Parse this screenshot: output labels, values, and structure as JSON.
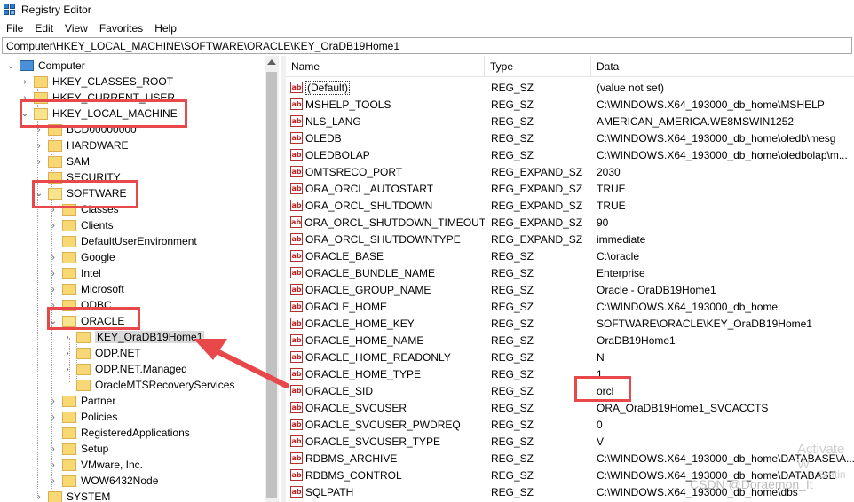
{
  "window": {
    "title": "Registry Editor"
  },
  "menu": [
    "File",
    "Edit",
    "View",
    "Favorites",
    "Help"
  ],
  "address": "Computer\\HKEY_LOCAL_MACHINE\\SOFTWARE\\ORACLE\\KEY_OraDB19Home1",
  "tree": {
    "root": "Computer",
    "hkcr": "HKEY_CLASSES_ROOT",
    "hkcu": "HKEY_CURRENT_USER",
    "hklm": "HKEY_LOCAL_MACHINE",
    "bcd": "BCD00000000",
    "hardware": "HARDWARE",
    "sam": "SAM",
    "security": "SECURITY",
    "software": "SOFTWARE",
    "classes": "Classes",
    "clients": "Clients",
    "defaultuserenv": "DefaultUserEnvironment",
    "google": "Google",
    "intel": "Intel",
    "microsoft": "Microsoft",
    "odbc": "ODBC",
    "oracle": "ORACLE",
    "key_oradb": "KEY_OraDB19Home1",
    "odp_net": "ODP.NET",
    "odp_net_managed": "ODP.NET.Managed",
    "oraclemts": "OracleMTSRecoveryServices",
    "partner": "Partner",
    "policies": "Policies",
    "registeredapps": "RegisteredApplications",
    "setup": "Setup",
    "vmware": "VMware, Inc.",
    "wow6432": "WOW6432Node",
    "system": "SYSTEM"
  },
  "columns": {
    "name": "Name",
    "type": "Type",
    "data": "Data"
  },
  "values": [
    {
      "name": "(Default)",
      "type": "REG_SZ",
      "data": "(value not set)"
    },
    {
      "name": "MSHELP_TOOLS",
      "type": "REG_SZ",
      "data": "C:\\WINDOWS.X64_193000_db_home\\MSHELP"
    },
    {
      "name": "NLS_LANG",
      "type": "REG_SZ",
      "data": "AMERICAN_AMERICA.WE8MSWIN1252"
    },
    {
      "name": "OLEDB",
      "type": "REG_SZ",
      "data": "C:\\WINDOWS.X64_193000_db_home\\oledb\\mesg"
    },
    {
      "name": "OLEDBOLAP",
      "type": "REG_SZ",
      "data": "C:\\WINDOWS.X64_193000_db_home\\oledbolap\\m..."
    },
    {
      "name": "OMTSRECO_PORT",
      "type": "REG_EXPAND_SZ",
      "data": "2030"
    },
    {
      "name": "ORA_ORCL_AUTOSTART",
      "type": "REG_EXPAND_SZ",
      "data": "TRUE"
    },
    {
      "name": "ORA_ORCL_SHUTDOWN",
      "type": "REG_EXPAND_SZ",
      "data": "TRUE"
    },
    {
      "name": "ORA_ORCL_SHUTDOWN_TIMEOUT",
      "type": "REG_EXPAND_SZ",
      "data": "90"
    },
    {
      "name": "ORA_ORCL_SHUTDOWNTYPE",
      "type": "REG_EXPAND_SZ",
      "data": "immediate"
    },
    {
      "name": "ORACLE_BASE",
      "type": "REG_SZ",
      "data": "C:\\oracle"
    },
    {
      "name": "ORACLE_BUNDLE_NAME",
      "type": "REG_SZ",
      "data": "Enterprise"
    },
    {
      "name": "ORACLE_GROUP_NAME",
      "type": "REG_SZ",
      "data": "Oracle - OraDB19Home1"
    },
    {
      "name": "ORACLE_HOME",
      "type": "REG_SZ",
      "data": "C:\\WINDOWS.X64_193000_db_home"
    },
    {
      "name": "ORACLE_HOME_KEY",
      "type": "REG_SZ",
      "data": "SOFTWARE\\ORACLE\\KEY_OraDB19Home1"
    },
    {
      "name": "ORACLE_HOME_NAME",
      "type": "REG_SZ",
      "data": "OraDB19Home1"
    },
    {
      "name": "ORACLE_HOME_READONLY",
      "type": "REG_SZ",
      "data": "N"
    },
    {
      "name": "ORACLE_HOME_TYPE",
      "type": "REG_SZ",
      "data": "1"
    },
    {
      "name": "ORACLE_SID",
      "type": "REG_SZ",
      "data": "orcl"
    },
    {
      "name": "ORACLE_SVCUSER",
      "type": "REG_SZ",
      "data": "ORA_OraDB19Home1_SVCACCTS"
    },
    {
      "name": "ORACLE_SVCUSER_PWDREQ",
      "type": "REG_SZ",
      "data": "0"
    },
    {
      "name": "ORACLE_SVCUSER_TYPE",
      "type": "REG_SZ",
      "data": "V"
    },
    {
      "name": "RDBMS_ARCHIVE",
      "type": "REG_SZ",
      "data": "C:\\WINDOWS.X64_193000_db_home\\DATABASE\\A..."
    },
    {
      "name": "RDBMS_CONTROL",
      "type": "REG_SZ",
      "data": "C:\\WINDOWS.X64_193000_db_home\\DATABASE"
    },
    {
      "name": "SQLPATH",
      "type": "REG_SZ",
      "data": "C:\\WINDOWS.X64_193000_db_home\\dbs"
    }
  ],
  "value_icon_text": "ab",
  "watermark": {
    "csdn": "CSDN @Doraemon_It",
    "activate": "Activate W",
    "settings": "Settin"
  },
  "colors": {
    "annotation": "#e8484a",
    "folder": "#f8d775"
  }
}
